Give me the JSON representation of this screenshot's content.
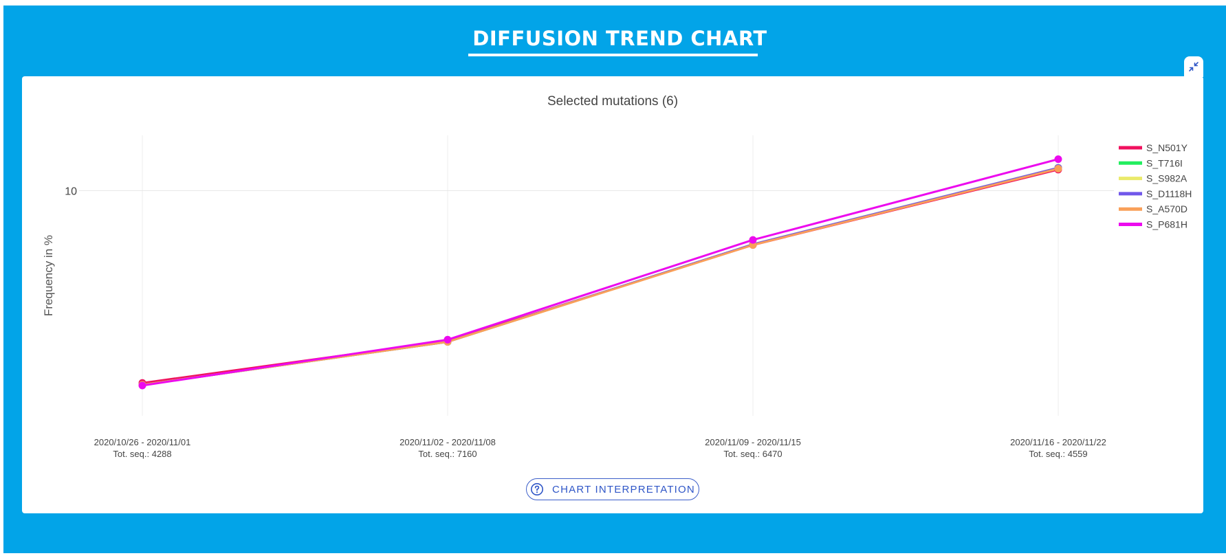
{
  "header": {
    "title": "DIFFUSION TREND CHART",
    "icon": "line-chart-icon"
  },
  "card": {
    "collapse_icon": "collapse-icon",
    "interpretation_button": {
      "label": "CHART INTERPRETATION",
      "icon": "help-circle-icon"
    }
  },
  "colors": {
    "background": "#02a4e8",
    "card": "#ffffff",
    "button_accent": "#2f56c7"
  },
  "chart_data": {
    "type": "line",
    "title": "Selected mutations (6)",
    "ylabel": "Frequency in %",
    "xlabel": "",
    "y_scale": "log",
    "y_ticks": [
      10
    ],
    "ylim": [
      1.3,
      16.5
    ],
    "grid": true,
    "legend_position": "top-right",
    "categories": [
      {
        "period": "2020/10/26 - 2020/11/01",
        "total": "Tot. seq.: 4288"
      },
      {
        "period": "2020/11/02 - 2020/11/08",
        "total": "Tot. seq.: 7160"
      },
      {
        "period": "2020/11/09 - 2020/11/15",
        "total": "Tot. seq.: 6470"
      },
      {
        "period": "2020/11/16 - 2020/11/22",
        "total": "Tot. seq.: 4559"
      }
    ],
    "series": [
      {
        "name": "S_N501Y",
        "color": "#f0115e",
        "values": [
          1.75,
          2.56,
          6.11,
          12.1
        ]
      },
      {
        "name": "S_T716I",
        "color": "#21ee5e",
        "values": [
          1.72,
          2.54,
          6.15,
          12.3
        ]
      },
      {
        "name": "S_S982A",
        "color": "#eaea6a",
        "values": [
          1.72,
          2.54,
          6.15,
          12.3
        ]
      },
      {
        "name": "S_D1118H",
        "color": "#7158ea",
        "values": [
          1.72,
          2.54,
          6.15,
          12.3
        ]
      },
      {
        "name": "S_A570D",
        "color": "#f9a059",
        "values": [
          1.72,
          2.54,
          6.11,
          12.2
        ]
      },
      {
        "name": "S_P681H",
        "color": "#ec0aee",
        "values": [
          1.71,
          2.59,
          6.4,
          13.3
        ]
      }
    ]
  }
}
